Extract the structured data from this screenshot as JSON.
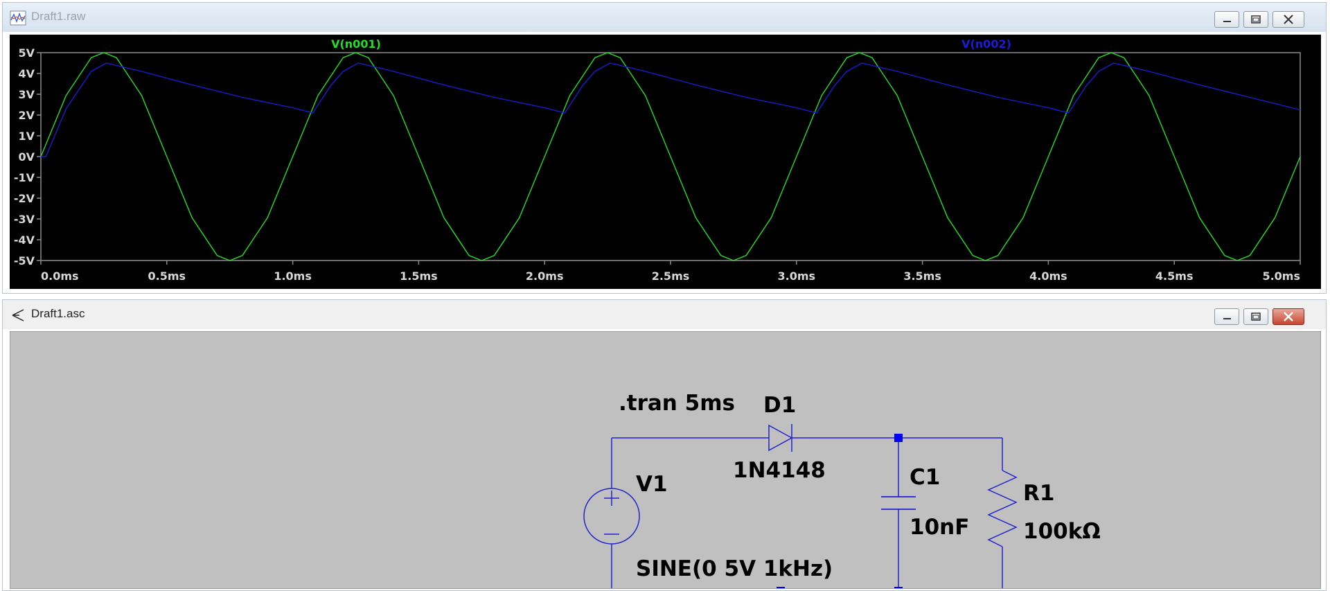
{
  "raw_window": {
    "title": "Draft1.raw",
    "icon": "waveform-plot-icon"
  },
  "asc_window": {
    "title": "Draft1.asc",
    "icon": "schematic-probe-icon"
  },
  "window_controls": {
    "minimize": "minimize-icon",
    "maximize": "maximize-icon",
    "close": "close-icon"
  },
  "chart_data": {
    "type": "line",
    "xlim": [
      0,
      5
    ],
    "ylim": [
      -5,
      5
    ],
    "x_ticks": [
      "0.0ms",
      "0.5ms",
      "1.0ms",
      "1.5ms",
      "2.0ms",
      "2.5ms",
      "3.0ms",
      "3.5ms",
      "4.0ms",
      "4.5ms",
      "5.0ms"
    ],
    "y_ticks": [
      "5V",
      "4V",
      "3V",
      "2V",
      "1V",
      "0V",
      "-1V",
      "-2V",
      "-3V",
      "-4V",
      "-5V"
    ],
    "grid": false,
    "series": [
      {
        "name": "V(n001)",
        "color": "#22dd22",
        "x": [
          0,
          0.1,
          0.2,
          0.25,
          0.3,
          0.4,
          0.5,
          0.6,
          0.7,
          0.75,
          0.8,
          0.9,
          1.0,
          1.1,
          1.2,
          1.25,
          1.3,
          1.4,
          1.5,
          1.6,
          1.7,
          1.75,
          1.8,
          1.9,
          2.0,
          2.1,
          2.2,
          2.25,
          2.3,
          2.4,
          2.5,
          2.6,
          2.7,
          2.75,
          2.8,
          2.9,
          3.0,
          3.1,
          3.2,
          3.25,
          3.3,
          3.4,
          3.5,
          3.6,
          3.7,
          3.75,
          3.8,
          3.9,
          4.0,
          4.1,
          4.2,
          4.25,
          4.3,
          4.4,
          4.5,
          4.6,
          4.7,
          4.75,
          4.8,
          4.9,
          5.0
        ],
        "y": [
          0,
          2.94,
          4.76,
          5,
          4.76,
          2.94,
          0,
          -2.94,
          -4.76,
          -5,
          -4.76,
          -2.94,
          0,
          2.94,
          4.76,
          5,
          4.76,
          2.94,
          0,
          -2.94,
          -4.76,
          -5,
          -4.76,
          -2.94,
          0,
          2.94,
          4.76,
          5,
          4.76,
          2.94,
          0,
          -2.94,
          -4.76,
          -5,
          -4.76,
          -2.94,
          0,
          2.94,
          4.76,
          5,
          4.76,
          2.94,
          0,
          -2.94,
          -4.76,
          -5,
          -4.76,
          -2.94,
          0,
          2.94,
          4.76,
          5,
          4.76,
          2.94,
          0,
          -2.94,
          -4.76,
          -5,
          -4.76,
          -2.94,
          0
        ]
      },
      {
        "name": "V(n002)",
        "color": "#1b1bd8",
        "x": [
          0,
          0.02,
          0.1,
          0.2,
          0.26,
          0.4,
          0.6,
          0.8,
          1.0,
          1.08,
          1.15,
          1.2,
          1.26,
          1.4,
          1.6,
          1.8,
          2.0,
          2.08,
          2.15,
          2.2,
          2.26,
          2.4,
          2.6,
          2.8,
          3.0,
          3.08,
          3.15,
          3.2,
          3.26,
          3.4,
          3.6,
          3.8,
          4.0,
          4.08,
          4.15,
          4.2,
          4.26,
          4.4,
          4.6,
          4.8,
          5.0
        ],
        "y": [
          0,
          0,
          2.3,
          4.1,
          4.5,
          4.1,
          3.45,
          2.85,
          2.35,
          2.1,
          3.4,
          4.1,
          4.5,
          4.1,
          3.45,
          2.85,
          2.35,
          2.1,
          3.4,
          4.1,
          4.5,
          4.1,
          3.45,
          2.85,
          2.35,
          2.1,
          3.4,
          4.1,
          4.5,
          4.1,
          3.45,
          2.85,
          2.35,
          2.1,
          3.4,
          4.1,
          4.5,
          4.1,
          3.45,
          2.85,
          2.25
        ]
      }
    ]
  },
  "schematic": {
    "directive": ".tran 5ms",
    "diode": {
      "name": "D1",
      "value": "1N4148"
    },
    "source": {
      "name": "V1",
      "value": "SINE(0 5V 1kHz)"
    },
    "capacitor": {
      "name": "C1",
      "value": "10nF"
    },
    "resistor": {
      "name": "R1",
      "value": "100kΩ"
    },
    "wire_color": "#2222cc",
    "junction_color": "#0000ff"
  }
}
